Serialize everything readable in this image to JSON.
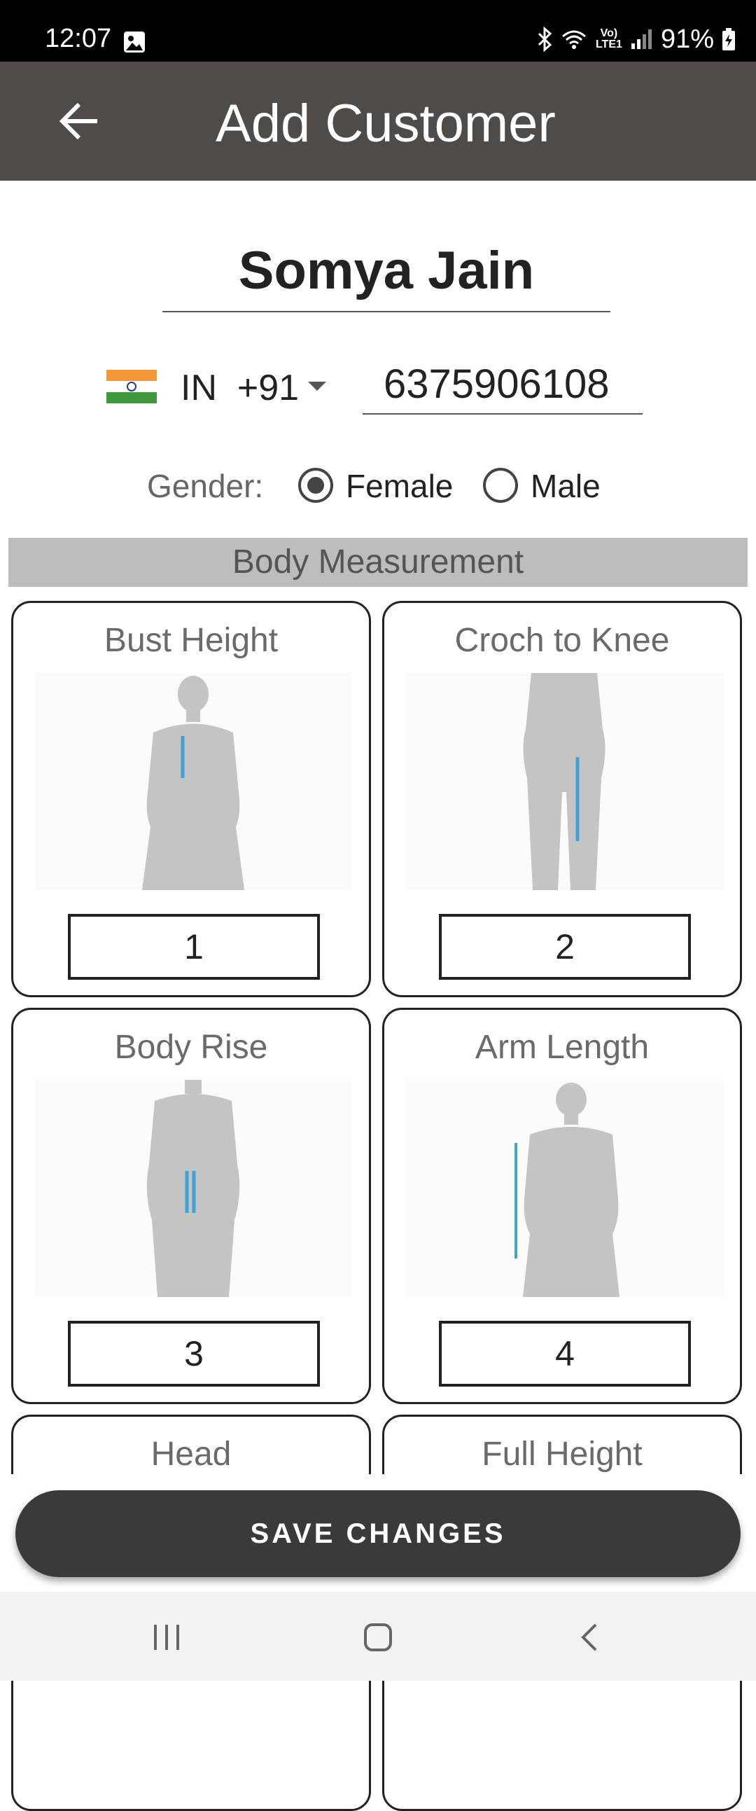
{
  "status_bar": {
    "time": "12:07",
    "battery": "91%",
    "network_label": "Vo) LTE1"
  },
  "app_bar": {
    "title": "Add Customer",
    "back_icon": "arrow-left-icon"
  },
  "customer": {
    "name": "Somya Jain",
    "country_flag": "india-flag-icon",
    "country_code": "IN  +91",
    "phone": "6375906108"
  },
  "gender": {
    "label": "Gender:",
    "options": [
      {
        "label": "Female",
        "selected": true
      },
      {
        "label": "Male",
        "selected": false
      }
    ]
  },
  "measurements": {
    "section_title": "Body Measurement",
    "items": [
      {
        "label": "Bust Height",
        "value": "1"
      },
      {
        "label": "Croch to Knee",
        "value": "2"
      },
      {
        "label": "Body Rise",
        "value": "3"
      },
      {
        "label": "Arm Length",
        "value": "4"
      },
      {
        "label": "Head",
        "value": ""
      },
      {
        "label": "Full Height",
        "value": ""
      }
    ]
  },
  "save_button": {
    "label": "SAVE CHANGES"
  },
  "nav": {
    "recents": "recents-icon",
    "home": "home-icon",
    "back": "back-icon"
  },
  "colors": {
    "app_bar": "#4e4b49",
    "section_header": "#bdbdbd",
    "measure_line": "#3fa3d1",
    "silhouette": "#c4c4c4",
    "save_button": "#3a3a3a"
  }
}
